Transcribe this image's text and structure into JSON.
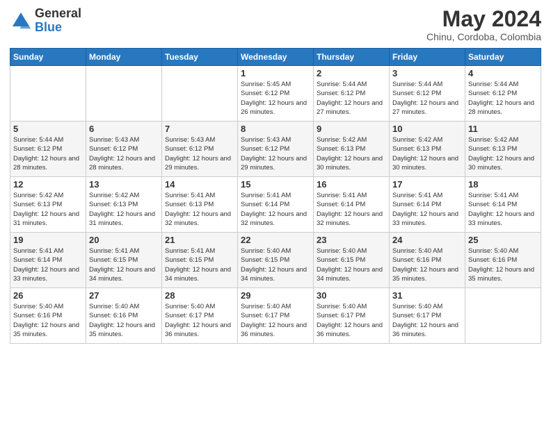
{
  "logo": {
    "general": "General",
    "blue": "Blue"
  },
  "header": {
    "month_year": "May 2024",
    "location": "Chinu, Cordoba, Colombia"
  },
  "weekdays": [
    "Sunday",
    "Monday",
    "Tuesday",
    "Wednesday",
    "Thursday",
    "Friday",
    "Saturday"
  ],
  "weeks": [
    [
      {
        "day": "",
        "info": ""
      },
      {
        "day": "",
        "info": ""
      },
      {
        "day": "",
        "info": ""
      },
      {
        "day": "1",
        "info": "Sunrise: 5:45 AM\nSunset: 6:12 PM\nDaylight: 12 hours and 26 minutes."
      },
      {
        "day": "2",
        "info": "Sunrise: 5:44 AM\nSunset: 6:12 PM\nDaylight: 12 hours and 27 minutes."
      },
      {
        "day": "3",
        "info": "Sunrise: 5:44 AM\nSunset: 6:12 PM\nDaylight: 12 hours and 27 minutes."
      },
      {
        "day": "4",
        "info": "Sunrise: 5:44 AM\nSunset: 6:12 PM\nDaylight: 12 hours and 28 minutes."
      }
    ],
    [
      {
        "day": "5",
        "info": "Sunrise: 5:44 AM\nSunset: 6:12 PM\nDaylight: 12 hours and 28 minutes."
      },
      {
        "day": "6",
        "info": "Sunrise: 5:43 AM\nSunset: 6:12 PM\nDaylight: 12 hours and 28 minutes."
      },
      {
        "day": "7",
        "info": "Sunrise: 5:43 AM\nSunset: 6:12 PM\nDaylight: 12 hours and 29 minutes."
      },
      {
        "day": "8",
        "info": "Sunrise: 5:43 AM\nSunset: 6:12 PM\nDaylight: 12 hours and 29 minutes."
      },
      {
        "day": "9",
        "info": "Sunrise: 5:42 AM\nSunset: 6:13 PM\nDaylight: 12 hours and 30 minutes."
      },
      {
        "day": "10",
        "info": "Sunrise: 5:42 AM\nSunset: 6:13 PM\nDaylight: 12 hours and 30 minutes."
      },
      {
        "day": "11",
        "info": "Sunrise: 5:42 AM\nSunset: 6:13 PM\nDaylight: 12 hours and 30 minutes."
      }
    ],
    [
      {
        "day": "12",
        "info": "Sunrise: 5:42 AM\nSunset: 6:13 PM\nDaylight: 12 hours and 31 minutes."
      },
      {
        "day": "13",
        "info": "Sunrise: 5:42 AM\nSunset: 6:13 PM\nDaylight: 12 hours and 31 minutes."
      },
      {
        "day": "14",
        "info": "Sunrise: 5:41 AM\nSunset: 6:13 PM\nDaylight: 12 hours and 32 minutes."
      },
      {
        "day": "15",
        "info": "Sunrise: 5:41 AM\nSunset: 6:14 PM\nDaylight: 12 hours and 32 minutes."
      },
      {
        "day": "16",
        "info": "Sunrise: 5:41 AM\nSunset: 6:14 PM\nDaylight: 12 hours and 32 minutes."
      },
      {
        "day": "17",
        "info": "Sunrise: 5:41 AM\nSunset: 6:14 PM\nDaylight: 12 hours and 33 minutes."
      },
      {
        "day": "18",
        "info": "Sunrise: 5:41 AM\nSunset: 6:14 PM\nDaylight: 12 hours and 33 minutes."
      }
    ],
    [
      {
        "day": "19",
        "info": "Sunrise: 5:41 AM\nSunset: 6:14 PM\nDaylight: 12 hours and 33 minutes."
      },
      {
        "day": "20",
        "info": "Sunrise: 5:41 AM\nSunset: 6:15 PM\nDaylight: 12 hours and 34 minutes."
      },
      {
        "day": "21",
        "info": "Sunrise: 5:41 AM\nSunset: 6:15 PM\nDaylight: 12 hours and 34 minutes."
      },
      {
        "day": "22",
        "info": "Sunrise: 5:40 AM\nSunset: 6:15 PM\nDaylight: 12 hours and 34 minutes."
      },
      {
        "day": "23",
        "info": "Sunrise: 5:40 AM\nSunset: 6:15 PM\nDaylight: 12 hours and 34 minutes."
      },
      {
        "day": "24",
        "info": "Sunrise: 5:40 AM\nSunset: 6:16 PM\nDaylight: 12 hours and 35 minutes."
      },
      {
        "day": "25",
        "info": "Sunrise: 5:40 AM\nSunset: 6:16 PM\nDaylight: 12 hours and 35 minutes."
      }
    ],
    [
      {
        "day": "26",
        "info": "Sunrise: 5:40 AM\nSunset: 6:16 PM\nDaylight: 12 hours and 35 minutes."
      },
      {
        "day": "27",
        "info": "Sunrise: 5:40 AM\nSunset: 6:16 PM\nDaylight: 12 hours and 35 minutes."
      },
      {
        "day": "28",
        "info": "Sunrise: 5:40 AM\nSunset: 6:17 PM\nDaylight: 12 hours and 36 minutes."
      },
      {
        "day": "29",
        "info": "Sunrise: 5:40 AM\nSunset: 6:17 PM\nDaylight: 12 hours and 36 minutes."
      },
      {
        "day": "30",
        "info": "Sunrise: 5:40 AM\nSunset: 6:17 PM\nDaylight: 12 hours and 36 minutes."
      },
      {
        "day": "31",
        "info": "Sunrise: 5:40 AM\nSunset: 6:17 PM\nDaylight: 12 hours and 36 minutes."
      },
      {
        "day": "",
        "info": ""
      }
    ]
  ]
}
